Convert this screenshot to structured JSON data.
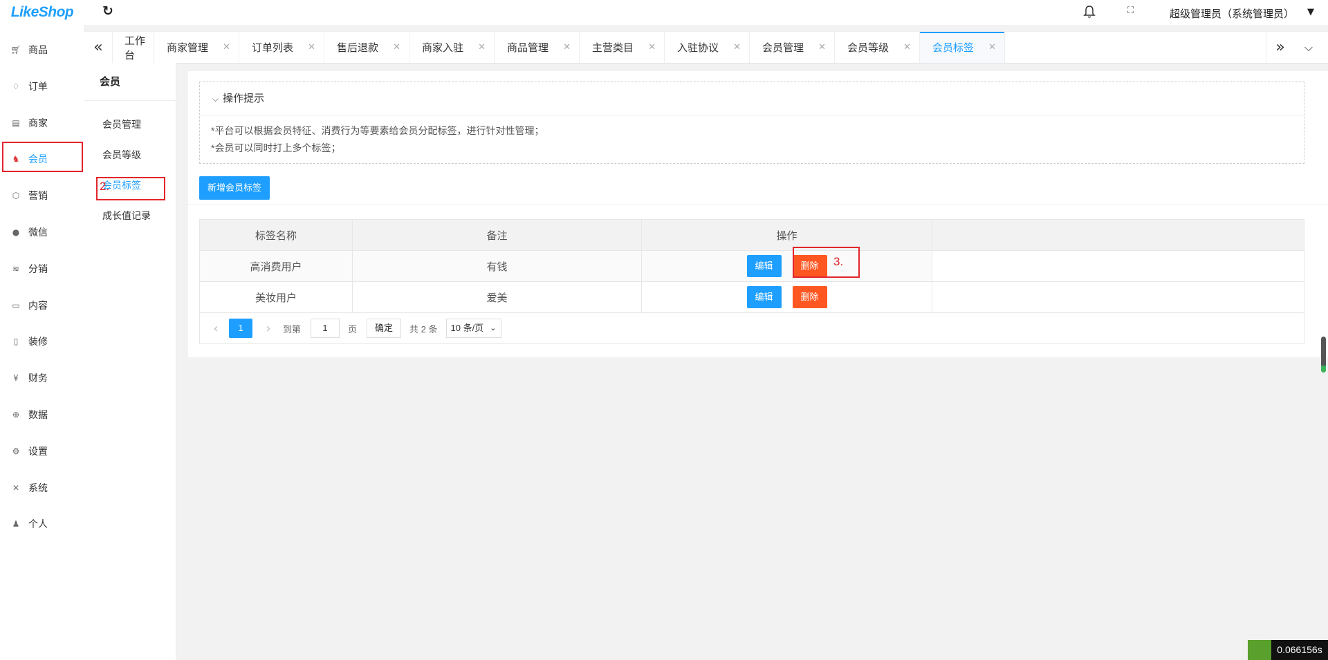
{
  "app": {
    "logo_text": "LikeShop"
  },
  "sidebar": {
    "items": [
      {
        "icon": "cart-icon",
        "label": "商品"
      },
      {
        "icon": "bell-icon",
        "label": "订单"
      },
      {
        "icon": "shop-icon",
        "label": "商家"
      },
      {
        "icon": "member-icon",
        "label": "会员",
        "active": true
      },
      {
        "icon": "cube-icon",
        "label": "营销"
      },
      {
        "icon": "wechat-icon",
        "label": "微信"
      },
      {
        "icon": "layers-icon",
        "label": "分销"
      },
      {
        "icon": "book-icon",
        "label": "内容"
      },
      {
        "icon": "mobile-icon",
        "label": "装修"
      },
      {
        "icon": "yen-icon",
        "label": "财务"
      },
      {
        "icon": "globe-icon",
        "label": "数据"
      },
      {
        "icon": "gear-icon",
        "label": "设置"
      },
      {
        "icon": "tools-icon",
        "label": "系统"
      },
      {
        "icon": "user-icon",
        "label": "个人"
      }
    ]
  },
  "header": {
    "user_label": "超级管理员（系统管理员）"
  },
  "tabs": [
    {
      "label": "工作台",
      "closable": false
    },
    {
      "label": "商家管理",
      "closable": true
    },
    {
      "label": "订单列表",
      "closable": true
    },
    {
      "label": "售后退款",
      "closable": true
    },
    {
      "label": "商家入驻",
      "closable": true
    },
    {
      "label": "商品管理",
      "closable": true
    },
    {
      "label": "主营类目",
      "closable": true
    },
    {
      "label": "入驻协议",
      "closable": true
    },
    {
      "label": "会员管理",
      "closable": true
    },
    {
      "label": "会员等级",
      "closable": true
    },
    {
      "label": "会员标签",
      "closable": true,
      "active": true
    }
  ],
  "subnav": {
    "title": "会员",
    "items": [
      {
        "label": "会员管理"
      },
      {
        "label": "会员等级"
      },
      {
        "label": "会员标签",
        "active": true
      },
      {
        "label": "成长值记录"
      }
    ]
  },
  "tips": {
    "title": "操作提示",
    "lines": [
      "*平台可以根据会员特征、消费行为等要素给会员分配标签，进行针对性管理；",
      "*会员可以同时打上多个标签；"
    ]
  },
  "toolbar": {
    "add_label": "新增会员标签"
  },
  "table": {
    "headers": [
      "标签名称",
      "备注",
      "操作"
    ],
    "rows": [
      {
        "name": "高消费用户",
        "remark": "有钱"
      },
      {
        "name": "美妆用户",
        "remark": "爱美"
      }
    ],
    "edit_label": "编辑",
    "delete_label": "删除"
  },
  "pager": {
    "current_page": "1",
    "goto_label": "到第",
    "page_input": "1",
    "page_unit": "页",
    "confirm_label": "确定",
    "total_label": "共 2 条",
    "page_size_label": "10 条/页"
  },
  "annotations": {
    "step2": "2.",
    "step3": "3."
  },
  "timer": "0.066156s",
  "colors": {
    "primary": "#1e9fff",
    "danger": "#ff5722",
    "annotation": "#e2252b"
  }
}
